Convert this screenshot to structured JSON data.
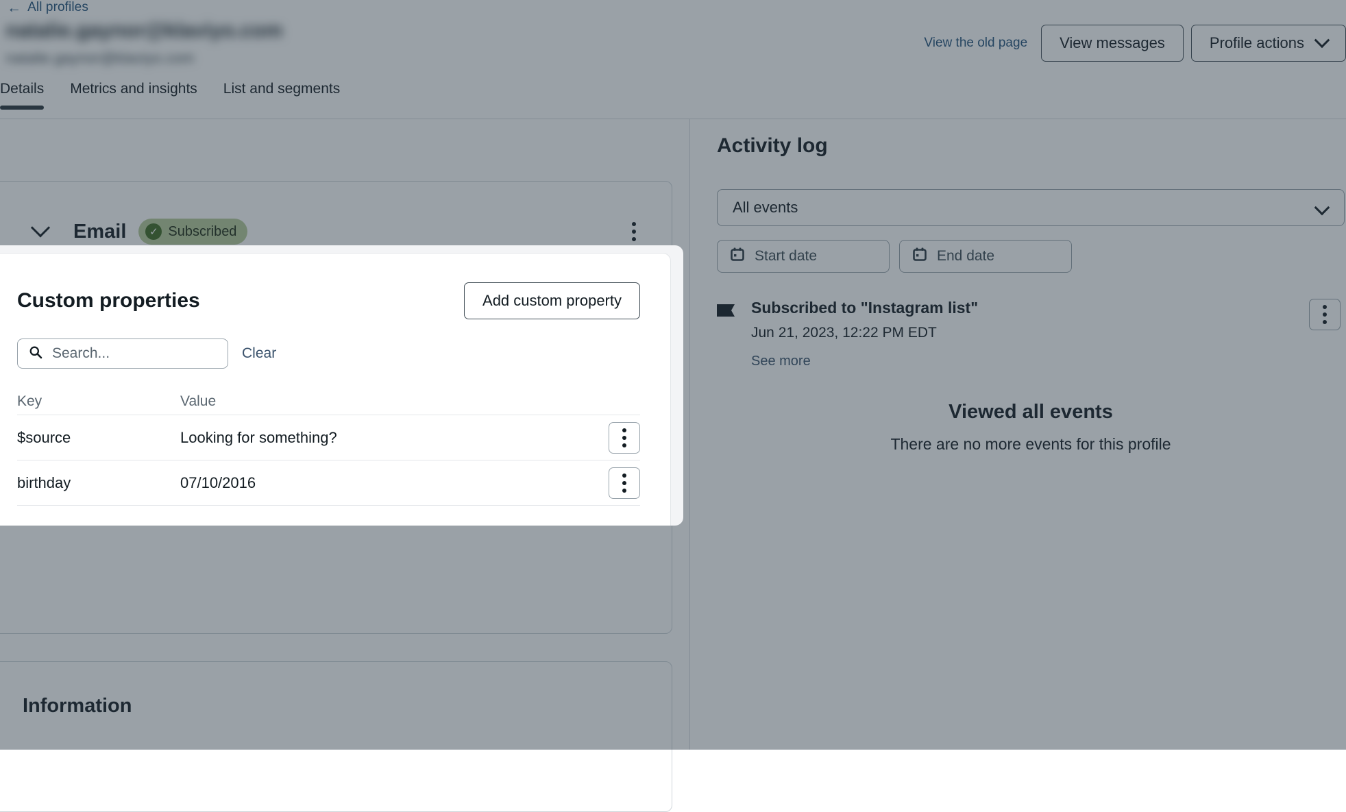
{
  "header": {
    "back_label": "All profiles",
    "back_icon": "arrow-left-icon",
    "profile_email_masked": "natalie.gaynor@klaviyo.com",
    "profile_email_secondary_masked": "natalie.gaynor@klaviyo.com",
    "view_old_page_label": "View the old page",
    "view_messages_label": "View messages",
    "profile_actions_label": "Profile actions",
    "profile_actions_icon": "chevron-down-icon"
  },
  "tabs": [
    {
      "label": "Details",
      "active": true
    },
    {
      "label": "Metrics and insights",
      "active": false
    },
    {
      "label": "List and segments",
      "active": false
    }
  ],
  "email_card": {
    "expand_icon": "chevron-down-icon",
    "title": "Email",
    "status_badge": "Subscribed",
    "status_icon": "check-circle-icon",
    "menu_icon": "kebab-menu-icon"
  },
  "custom_properties": {
    "title": "Custom properties",
    "add_button_label": "Add custom property",
    "search_placeholder": "Search...",
    "search_value": "",
    "search_icon": "search-icon",
    "clear_label": "Clear",
    "columns": [
      "Key",
      "Value"
    ],
    "rows": [
      {
        "key": "$source",
        "value": "Looking for something?",
        "menu_icon": "kebab-menu-icon"
      },
      {
        "key": "birthday",
        "value": "07/10/2016",
        "menu_icon": "kebab-menu-icon"
      }
    ]
  },
  "information_card": {
    "title": "Information"
  },
  "activity_log": {
    "title": "Activity log",
    "event_filter_value": "All events",
    "event_filter_icon": "chevron-down-icon",
    "start_date_placeholder": "Start date",
    "end_date_placeholder": "End date",
    "calendar_icon": "calendar-icon",
    "events": [
      {
        "icon": "flag-icon",
        "title": "Subscribed to \"Instagram list\"",
        "timestamp": "Jun 21, 2023, 12:22 PM EDT",
        "see_more_label": "See more",
        "menu_icon": "kebab-menu-icon"
      }
    ],
    "end_state_title": "Viewed all events",
    "end_state_subtitle": "There are no more events for this profile"
  },
  "colors": {
    "link": "#23527c",
    "text": "#131c22",
    "badge_bg": "#b6cb99",
    "badge_icon": "#3f6b22",
    "tab_active_underline": "#2a353d",
    "dim_overlay": "rgba(40,56,68,0.47)",
    "spotlight_bg": "#f3f4f6"
  }
}
